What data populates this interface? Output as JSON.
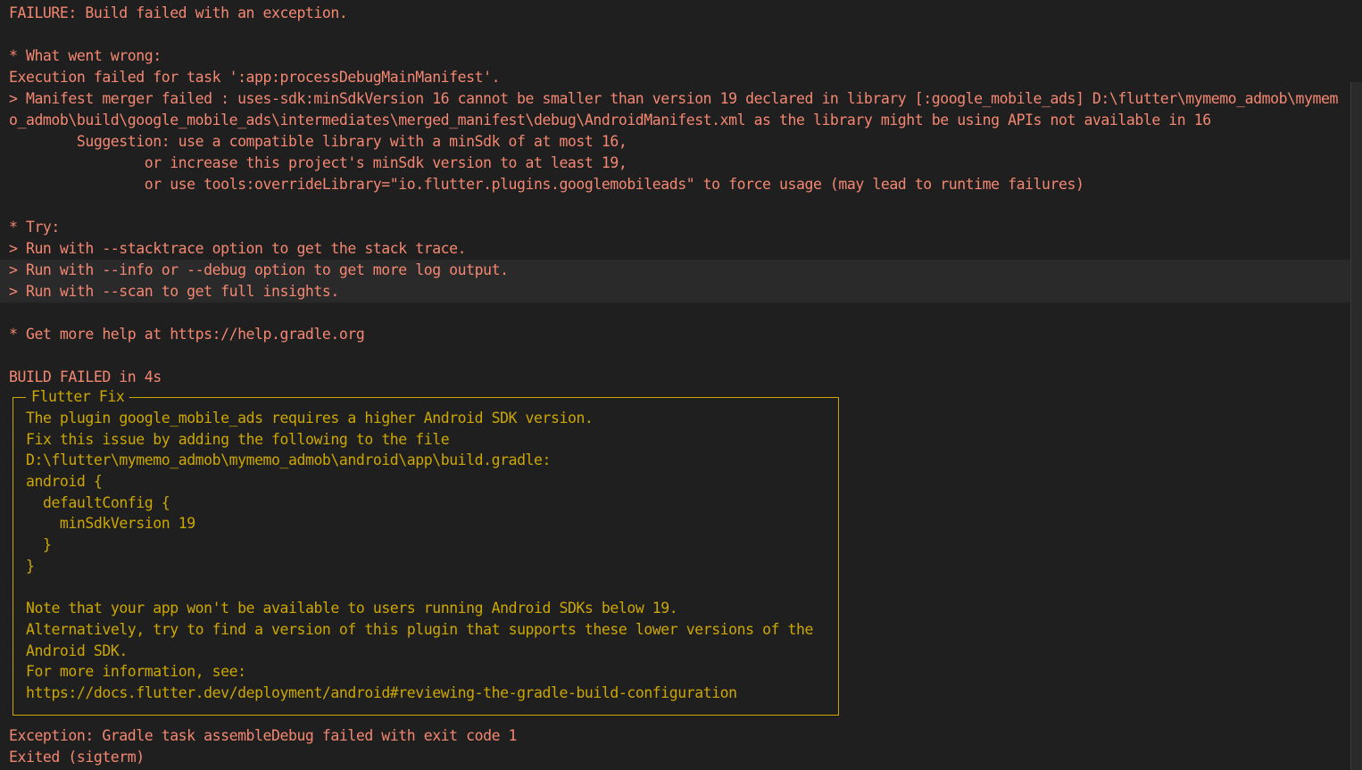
{
  "colors": {
    "background": "#1f1f1f",
    "error_text": "#f48771",
    "fix_text": "#cca700",
    "highlight_row": "#2a2a2a"
  },
  "terminal": {
    "failure": "FAILURE: Build failed with an exception.",
    "what_went_wrong_header": "* What went wrong:",
    "execution_failed": "Execution failed for task ':app:processDebugMainManifest'.",
    "manifest_merger": "> Manifest merger failed : uses-sdk:minSdkVersion 16 cannot be smaller than version 19 declared in library [:google_mobile_ads] D:\\flutter\\mymemo_admob\\mymemo_admob\\build\\google_mobile_ads\\intermediates\\merged_manifest\\debug\\AndroidManifest.xml as the library might be using APIs not available in 16",
    "suggestion_1": "        Suggestion: use a compatible library with a minSdk of at most 16,",
    "suggestion_2": "                or increase this project's minSdk version to at least 19,",
    "suggestion_3": "                or use tools:overrideLibrary=\"io.flutter.plugins.googlemobileads\" to force usage (may lead to runtime failures)",
    "try_header": "* Try:",
    "try_1": "> Run with --stacktrace option to get the stack trace.",
    "try_2": "> Run with --info or --debug option to get more log output.",
    "try_3": "> Run with --scan to get full insights.",
    "help": "* Get more help at https://help.gradle.org",
    "build_failed": "BUILD FAILED in 4s"
  },
  "flutter_fix": {
    "title": "Flutter Fix",
    "lines": [
      "The plugin google_mobile_ads requires a higher Android SDK version.",
      "Fix this issue by adding the following to the file",
      "D:\\flutter\\mymemo_admob\\mymemo_admob\\android\\app\\build.gradle:",
      "android {",
      "  defaultConfig {",
      "    minSdkVersion 19",
      "  }",
      "}",
      "",
      "Note that your app won't be available to users running Android SDKs below 19.",
      "Alternatively, try to find a version of this plugin that supports these lower versions of the",
      "Android SDK.",
      "For more information, see:",
      "https://docs.flutter.dev/deployment/android#reviewing-the-gradle-build-configuration"
    ]
  },
  "footer": {
    "exception": "Exception: Gradle task assembleDebug failed with exit code 1",
    "exited": "Exited (sigterm)"
  }
}
